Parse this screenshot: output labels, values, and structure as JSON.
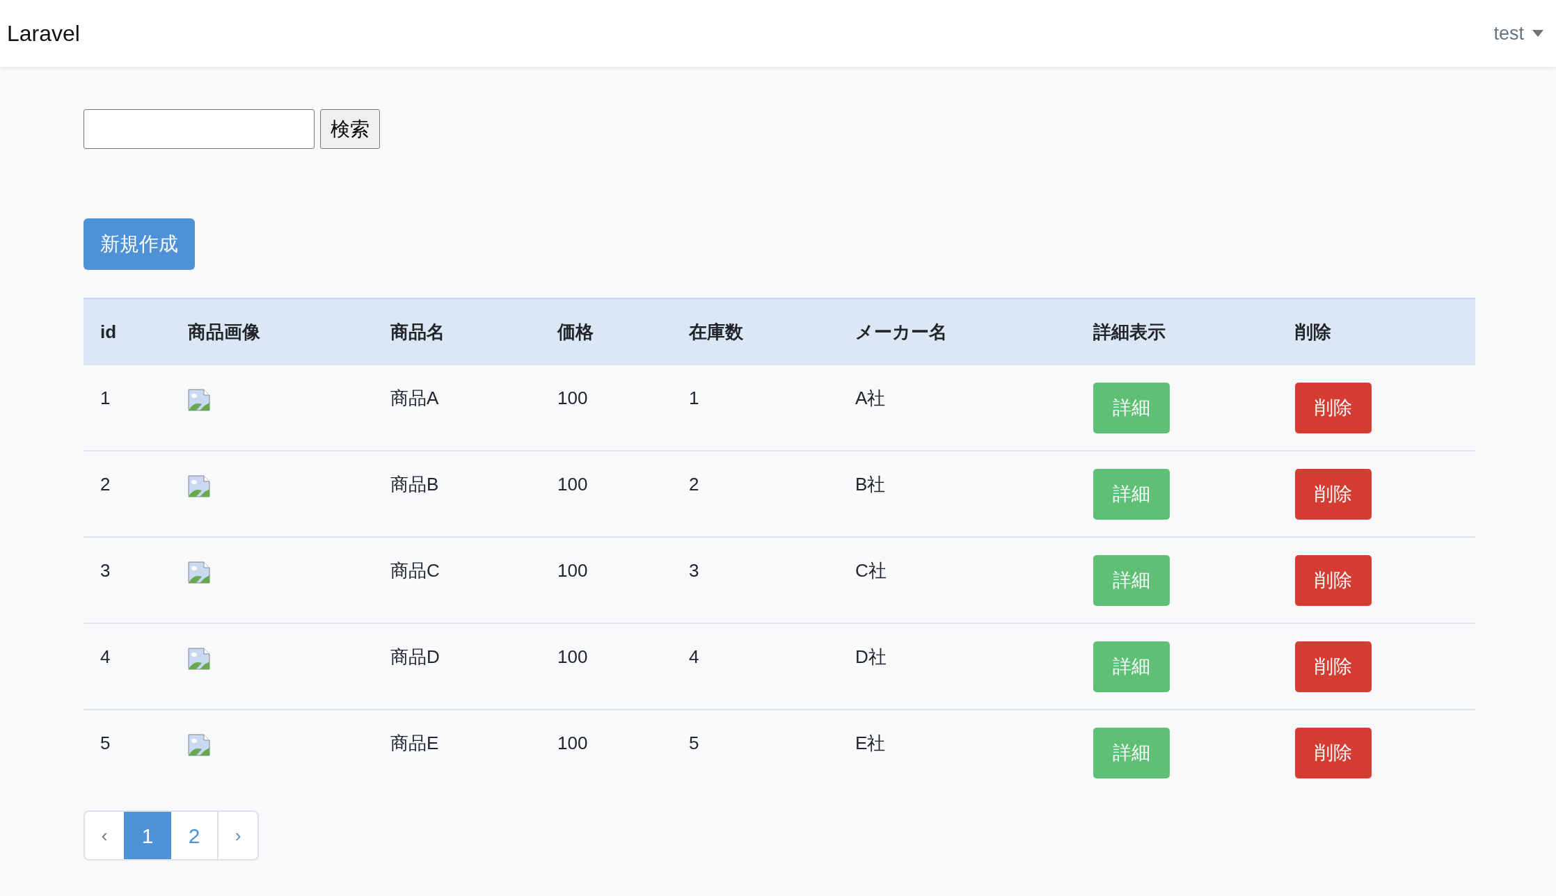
{
  "navbar": {
    "brand": "Laravel",
    "user": "test"
  },
  "search": {
    "button": "検索"
  },
  "create_button": "新規作成",
  "table": {
    "columns": [
      "id",
      "商品画像",
      "商品名",
      "価格",
      "在庫数",
      "メーカー名",
      "詳細表示",
      "削除"
    ],
    "rows": [
      {
        "id": "1",
        "name": "商品A",
        "price": "100",
        "stock": "1",
        "maker": "A社",
        "detail": "詳細",
        "delete": "削除"
      },
      {
        "id": "2",
        "name": "商品B",
        "price": "100",
        "stock": "2",
        "maker": "B社",
        "detail": "詳細",
        "delete": "削除"
      },
      {
        "id": "3",
        "name": "商品C",
        "price": "100",
        "stock": "3",
        "maker": "C社",
        "detail": "詳細",
        "delete": "削除"
      },
      {
        "id": "4",
        "name": "商品D",
        "price": "100",
        "stock": "4",
        "maker": "D社",
        "detail": "詳細",
        "delete": "削除"
      },
      {
        "id": "5",
        "name": "商品E",
        "price": "100",
        "stock": "5",
        "maker": "E社",
        "detail": "詳細",
        "delete": "削除"
      }
    ]
  },
  "pagination": {
    "prev": {
      "label": "‹",
      "disabled": true
    },
    "pages": [
      {
        "label": "1",
        "selected": true
      },
      {
        "label": "2",
        "selected": false
      }
    ],
    "next": {
      "label": "›",
      "disabled": false
    }
  }
}
